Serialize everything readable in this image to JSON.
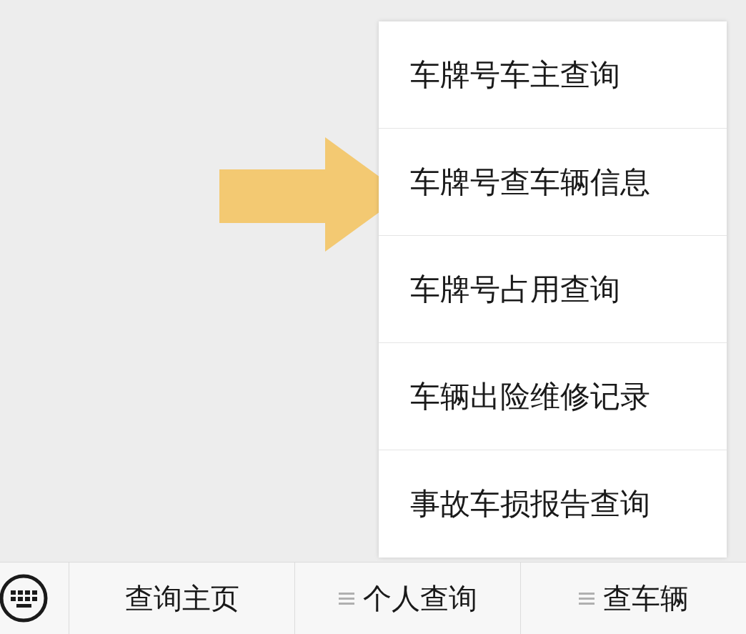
{
  "popup_menu": {
    "items": [
      {
        "label": "车牌号车主查询"
      },
      {
        "label": "车牌号查车辆信息"
      },
      {
        "label": "车牌号占用查询"
      },
      {
        "label": "车辆出险维修记录"
      },
      {
        "label": "事故车损报告查询"
      }
    ]
  },
  "bottom_menu": {
    "items": [
      {
        "label": "查询主页",
        "has_submenu": false
      },
      {
        "label": "个人查询",
        "has_submenu": true
      },
      {
        "label": "查车辆",
        "has_submenu": true
      }
    ]
  }
}
